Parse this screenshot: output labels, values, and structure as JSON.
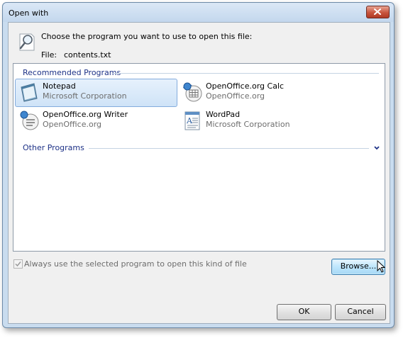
{
  "window": {
    "title": "Open with"
  },
  "header": {
    "prompt": "Choose the program you want to use to open this file:",
    "file_label": "File:",
    "file_name": "contents.txt"
  },
  "groups": {
    "recommended": "Recommended Programs",
    "other": "Other Programs"
  },
  "programs": [
    {
      "name": "Notepad",
      "publisher": "Microsoft Corporation",
      "icon": "notepad-icon",
      "selected": true
    },
    {
      "name": "OpenOffice.org Calc",
      "publisher": "OpenOffice.org",
      "icon": "openoffice-calc-icon",
      "selected": false
    },
    {
      "name": "OpenOffice.org Writer",
      "publisher": "OpenOffice.org",
      "icon": "openoffice-writer-icon",
      "selected": false
    },
    {
      "name": "WordPad",
      "publisher": "Microsoft Corporation",
      "icon": "wordpad-icon",
      "selected": false
    }
  ],
  "checkbox": {
    "label": "Always use the selected program to open this kind of file",
    "checked": true,
    "disabled": true
  },
  "buttons": {
    "browse": "Browse...",
    "ok": "OK",
    "cancel": "Cancel"
  },
  "colors": {
    "group_header": "#1e3287",
    "selection_border": "#84acdd",
    "close_button": "#c8553d"
  }
}
